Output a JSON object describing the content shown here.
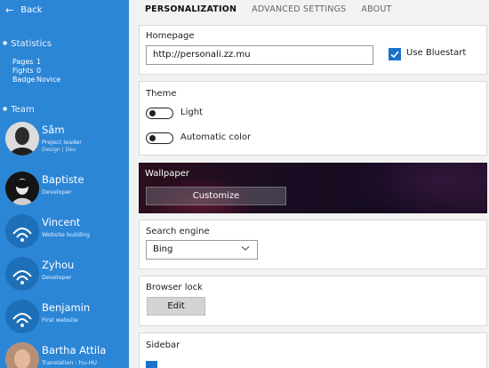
{
  "sidebar": {
    "back_label": "Back",
    "statistics_title": "Statistics",
    "stats": [
      {
        "label": "Pages",
        "value": "1"
      },
      {
        "label": "Fights",
        "value": "0"
      },
      {
        "label": "Badge",
        "value": "Novice"
      }
    ],
    "team_title": "Team",
    "members": [
      {
        "name": "Sâm",
        "role": "Project leader",
        "tags": "Design | Dev"
      },
      {
        "name": "Baptiste",
        "role": "Developer",
        "tags": ""
      },
      {
        "name": "Vincent",
        "role": "Website building",
        "tags": ""
      },
      {
        "name": "Zyhou",
        "role": "Developer",
        "tags": ""
      },
      {
        "name": "Benjamin",
        "role": "First website",
        "tags": ""
      },
      {
        "name": "Bartha Attila",
        "role": "Translation : hu-HU",
        "tags": ""
      }
    ]
  },
  "tabs": [
    {
      "label": "PERSONALIZATION",
      "active": true
    },
    {
      "label": "ADVANCED SETTINGS",
      "active": false
    },
    {
      "label": "ABOUT",
      "active": false
    }
  ],
  "homepage": {
    "title": "Homepage",
    "url_value": "http://personali.zz.mu",
    "checkbox_label": "Use Bluestart",
    "checked": true
  },
  "theme": {
    "title": "Theme",
    "light_label": "Light",
    "auto_color_label": "Automatic color"
  },
  "wallpaper": {
    "title": "Wallpaper",
    "customize_label": "Customize"
  },
  "search_engine": {
    "title": "Search engine",
    "selected": "Bing"
  },
  "browser_lock": {
    "title": "Browser lock",
    "edit_label": "Edit"
  },
  "sidebar_card": {
    "title": "Sidebar"
  },
  "colors": {
    "sidebar_bg": "#2c86d6",
    "accent": "#1a73c9"
  }
}
